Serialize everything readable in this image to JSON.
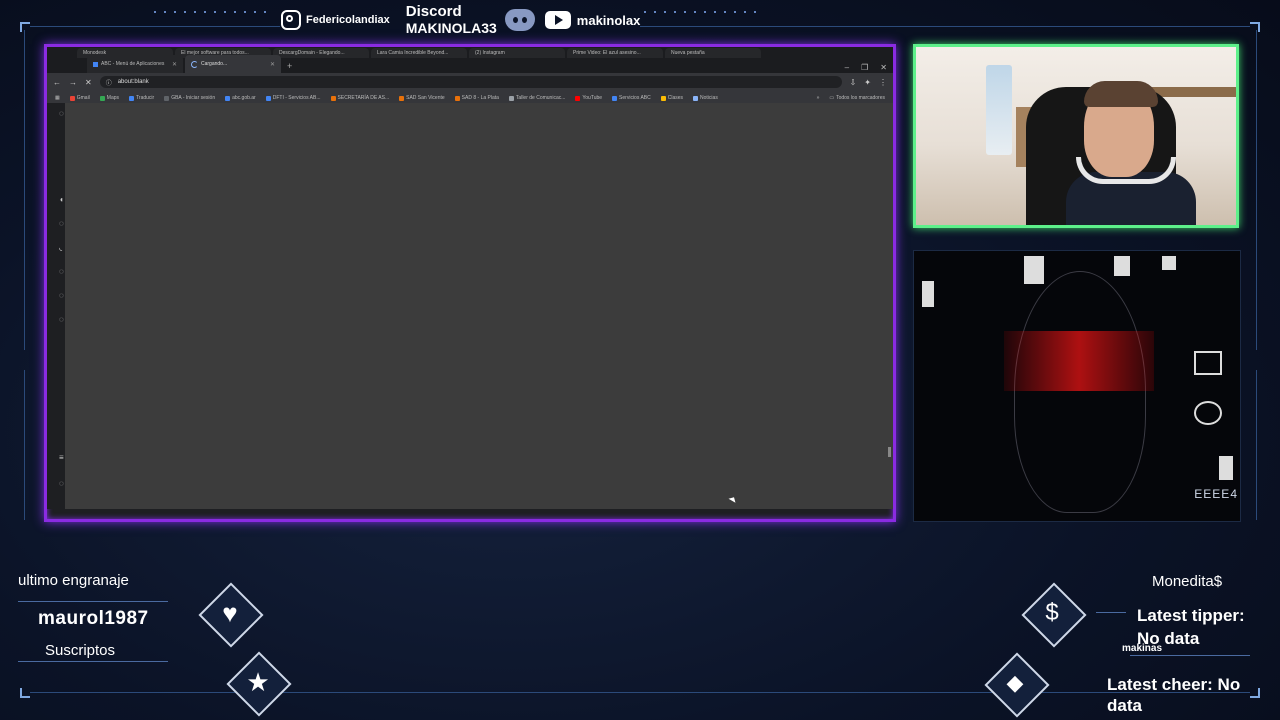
{
  "socials": {
    "instagram_handle": "Federicolandiax",
    "discord_label": "Discord",
    "discord_handle": "MAKINOLA33",
    "youtube_handle": "makinolax"
  },
  "browser": {
    "tabs": [
      {
        "label": "Monodesk",
        "active": false
      },
      {
        "label": "El mejor software para todos...",
        "active": false
      },
      {
        "label": "DescargDomain - Elegando...",
        "active": false
      },
      {
        "label": "Lara Camia Incredible Beyond...",
        "active": false
      },
      {
        "label": "(2) Instagram",
        "active": false
      },
      {
        "label": "Prime Video: El azul asesino...",
        "active": false
      },
      {
        "label": "Nueva pestaña",
        "active": false
      }
    ],
    "tabs_row2": [
      {
        "label": "ABC - Menú de Aplicaciones",
        "active": false
      },
      {
        "label": "Cargando...",
        "active": true
      }
    ],
    "url": "about:blank",
    "bookmarks": [
      {
        "label": "Gmail",
        "color": "#ea4335"
      },
      {
        "label": "Maps",
        "color": "#34a853"
      },
      {
        "label": "Traducir",
        "color": "#4285f4"
      },
      {
        "label": "GBA - Iniciar sesión",
        "color": "#5f6368"
      },
      {
        "label": "abc.gob.ar",
        "color": "#4285f4"
      },
      {
        "label": "DFTI - Servicios AB...",
        "color": "#4285f4"
      },
      {
        "label": "SECRETARÍA DE AS...",
        "color": "#e8710a"
      },
      {
        "label": "SAD San Vicente",
        "color": "#e8710a"
      },
      {
        "label": "SAD 8 - La Plata",
        "color": "#e8710a"
      },
      {
        "label": "Taller de Comunicac...",
        "color": "#9aa0a6"
      },
      {
        "label": "YouTube",
        "color": "#ff0000"
      },
      {
        "label": "Servicios ABC",
        "color": "#4285f4"
      },
      {
        "label": "Clases",
        "color": "#fbbc04"
      },
      {
        "label": "Noticias",
        "color": "#8ab4f8"
      }
    ],
    "all_bookmarks_label": "Todos los marcadores"
  },
  "glitch": {
    "label": "EEEE4"
  },
  "widgets": {
    "last_gear_label": "ultimo engranaje",
    "last_gear_user": "maurol1987",
    "subs_label": "Suscriptos",
    "coins_label": "Monedita$",
    "latest_tipper_label": "Latest tipper:",
    "latest_tipper_value": "No data",
    "currency_label": "makinas",
    "latest_cheer_label": "Latest cheer: No",
    "latest_cheer_value": "data"
  },
  "colors": {
    "main_frame_border": "#8a2be2",
    "cam_frame_border": "#5df08a",
    "background": "#0b1327"
  }
}
